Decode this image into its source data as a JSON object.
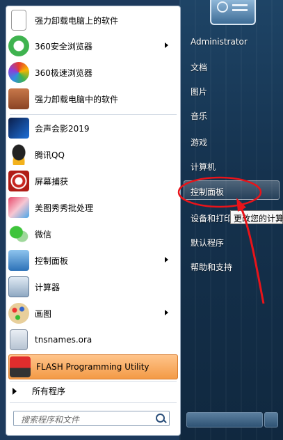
{
  "left_menu": {
    "items": [
      {
        "label": "强力卸载电脑上的软件",
        "icon": "document-icon"
      },
      {
        "label": "360安全浏览器",
        "icon": "360-browser-icon",
        "has_arrow": true
      },
      {
        "label": "360极速浏览器",
        "icon": "360-speed-browser-icon"
      },
      {
        "label": "强力卸载电脑中的软件",
        "icon": "uninstall-box-icon"
      },
      {
        "label": "会声会影2019",
        "icon": "video-editor-icon"
      },
      {
        "label": "腾讯QQ",
        "icon": "qq-penguin-icon"
      },
      {
        "label": "屏幕捕获",
        "icon": "screen-capture-icon"
      },
      {
        "label": "美图秀秀批处理",
        "icon": "meitu-icon"
      },
      {
        "label": "微信",
        "icon": "wechat-icon"
      },
      {
        "label": "控制面板",
        "icon": "control-panel-icon",
        "has_arrow": true
      },
      {
        "label": "计算器",
        "icon": "calculator-icon"
      },
      {
        "label": "画图",
        "icon": "paint-icon",
        "has_arrow": true
      },
      {
        "label": "tnsnames.ora",
        "icon": "file-icon"
      },
      {
        "label": "FLASH Programming Utility",
        "icon": "silicon-labs-icon",
        "highlighted": true
      }
    ],
    "all_programs": "所有程序",
    "search_placeholder": "搜索程序和文件"
  },
  "right_menu": {
    "user": "Administrator",
    "items": [
      "文档",
      "图片",
      "音乐",
      "游戏",
      "计算机",
      "控制面板",
      "设备和打印",
      "默认程序",
      "帮助和支持"
    ],
    "highlighted": "控制面板",
    "tooltip": "更改您的计算"
  },
  "colors": {
    "annotation": "#e8141a",
    "highlight_orange": "#f39a46"
  }
}
